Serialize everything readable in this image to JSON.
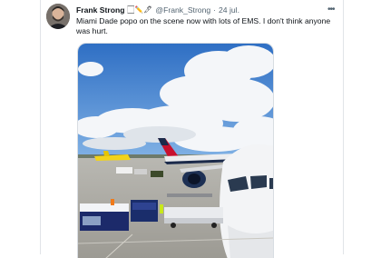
{
  "tweet": {
    "author_name": "Frank Strong",
    "name_emojis": "🏻✏️🖊",
    "handle": "@Frank_Strong",
    "separator": "·",
    "date": "24 jul.",
    "more_label": "•••",
    "text": "Miami Dade popo on the scene now with lots of EMS. I don't think anyone was hurt."
  },
  "media": {
    "description_icons": [
      "airplane",
      "tarmac",
      "ground-vehicles"
    ]
  },
  "colors": {
    "text_primary": "#0f1419",
    "text_secondary": "#536471",
    "sky": "#3f7fd0",
    "delta_red": "#c8102e",
    "spirit_yellow": "#f5d400"
  }
}
